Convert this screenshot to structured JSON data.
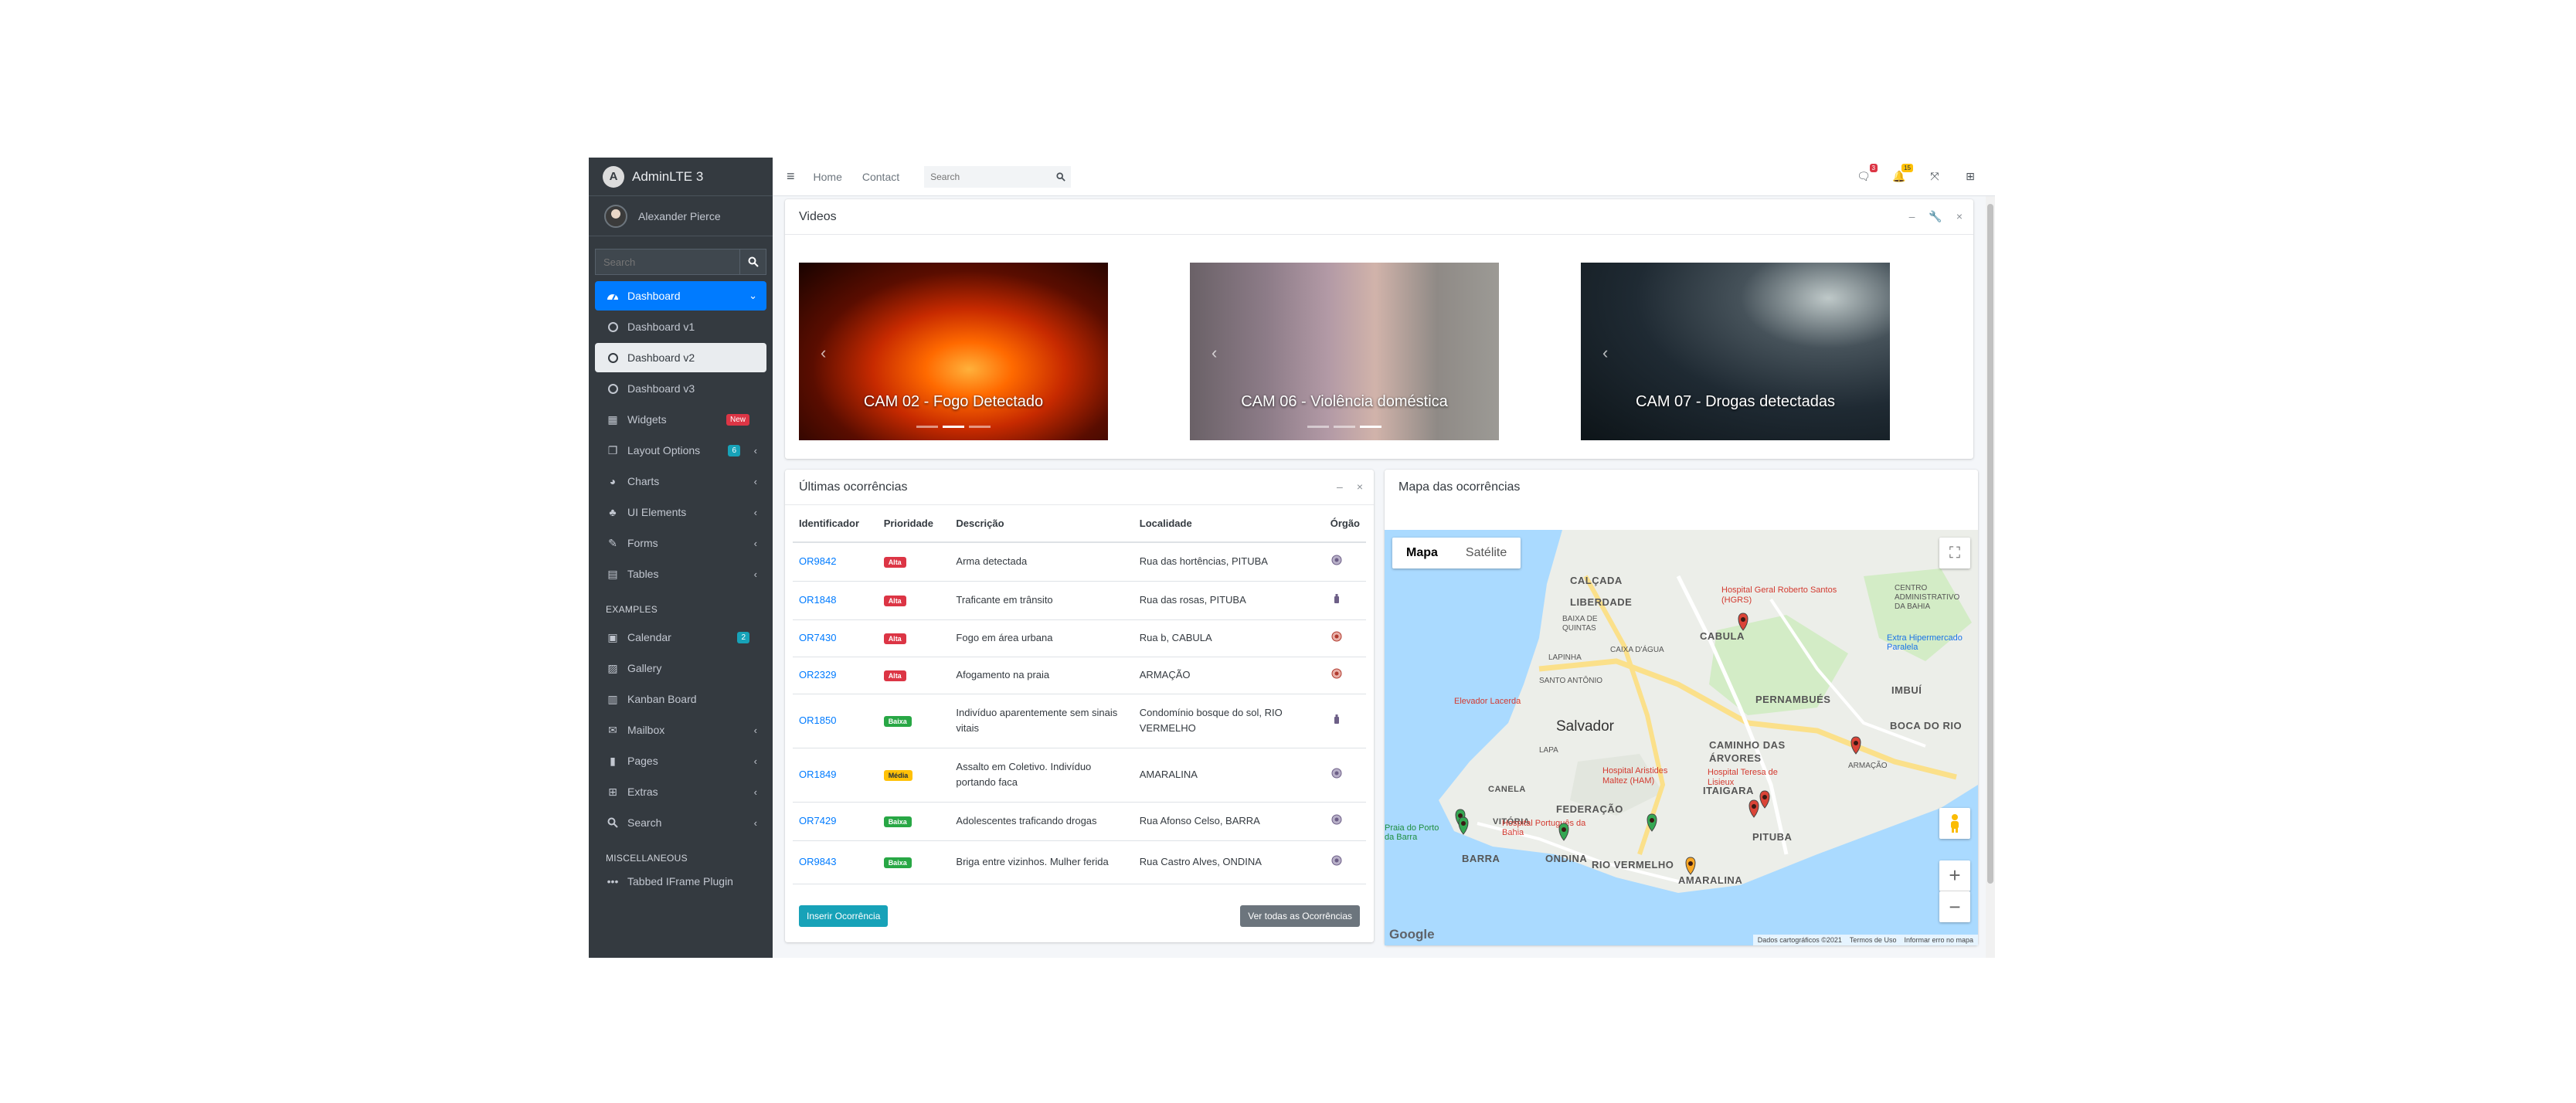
{
  "sidebar": {
    "brand": "AdminLTE 3",
    "user_name": "Alexander Pierce",
    "search_placeholder": "Search",
    "items": [
      {
        "label": "Dashboard"
      },
      {
        "label": "Dashboard v1"
      },
      {
        "label": "Dashboard v2"
      },
      {
        "label": "Dashboard v3"
      },
      {
        "label": "Widgets",
        "badge": "New"
      },
      {
        "label": "Layout Options",
        "badge": "6"
      },
      {
        "label": "Charts"
      },
      {
        "label": "UI Elements"
      },
      {
        "label": "Forms"
      },
      {
        "label": "Tables"
      }
    ],
    "header_examples": "EXAMPLES",
    "examples": [
      {
        "label": "Calendar",
        "badge": "2"
      },
      {
        "label": "Gallery"
      },
      {
        "label": "Kanban Board"
      },
      {
        "label": "Mailbox"
      },
      {
        "label": "Pages"
      },
      {
        "label": "Extras"
      },
      {
        "label": "Search"
      }
    ],
    "header_misc": "MISCELLANEOUS",
    "misc": [
      {
        "label": "Tabbed IFrame Plugin"
      }
    ]
  },
  "topbar": {
    "home": "Home",
    "contact": "Contact",
    "search_placeholder": "Search",
    "messages_count": "3",
    "notifications_count": "15"
  },
  "videos": {
    "title": "Videos",
    "items": [
      {
        "caption": "CAM 02 - Fogo Detectado"
      },
      {
        "caption": "CAM 06 - Violência doméstica"
      },
      {
        "caption": "CAM 07 - Drogas detectadas"
      }
    ]
  },
  "occurrences": {
    "title": "Últimas ocorrências",
    "columns": [
      "Identificador",
      "Prioridade",
      "Descrição",
      "Localidade",
      "Órgão"
    ],
    "rows": [
      {
        "id": "OR9842",
        "priority": "Alta",
        "description": "Arma detectada",
        "location": "Rua das hortências, PITUBA",
        "agency": "police-badge-icon"
      },
      {
        "id": "OR1848",
        "priority": "Alta",
        "description": "Traficante em trânsito",
        "location": "Rua das rosas, PITUBA",
        "agency": "fire-extinguisher-icon"
      },
      {
        "id": "OR7430",
        "priority": "Alta",
        "description": "Fogo em área urbana",
        "location": "Rua b, CABULA",
        "agency": "fire-department-icon"
      },
      {
        "id": "OR2329",
        "priority": "Alta",
        "description": "Afogamento na praia",
        "location": "ARMAÇÃO",
        "agency": "fire-department-icon"
      },
      {
        "id": "OR1850",
        "priority": "Baixa",
        "description": "Indivíduo aparentemente sem sinais vitais",
        "location": "Condomínio bosque do sol, RIO VERMELHO",
        "agency": "fire-extinguisher-icon"
      },
      {
        "id": "OR1849",
        "priority": "Média",
        "description": "Assalto em Coletivo. Indivíduo portando faca",
        "location": "AMARALINA",
        "agency": "police-badge-icon"
      },
      {
        "id": "OR7429",
        "priority": "Baixa",
        "description": "Adolescentes traficando drogas",
        "location": "Rua Afonso Celso, BARRA",
        "agency": "police-badge-icon"
      },
      {
        "id": "OR9843",
        "priority": "Baixa",
        "description": "Briga entre vizinhos. Mulher ferida",
        "location": "Rua Castro Alves, ONDINA",
        "agency": "police-badge-icon"
      }
    ],
    "insert_button": "Inserir Ocorrência",
    "view_all_button": "Ver todas as Ocorrências"
  },
  "map": {
    "title": "Mapa das ocorrências",
    "type_map": "Mapa",
    "type_satellite": "Satélite",
    "labels": [
      "CALÇADA",
      "LIBERDADE",
      "CABULA",
      "PERNAMBUÉS",
      "BOCA DO RIO",
      "IMBUÍ",
      "CAMINHO DAS ÁRVORES",
      "ITAIGARA",
      "PITUBA",
      "FEDERAÇÃO",
      "RIO VERMELHO",
      "ONDINA",
      "BARRA",
      "AMARALINA",
      "CANELA",
      "VITÓRIA",
      "Salvador"
    ],
    "pois": [
      "Hospital Geral Roberto Santos (HGRS)",
      "Hospital Aristides Maltez (HAM)",
      "Hospital Teresa de Lisieux",
      "Hospital Português da Bahia",
      "Elevador Lacerda",
      "CENTRO ADMINISTRATIVO DA BAHIA",
      "Extra Hipermercado Paralela",
      "ARMAÇÃO",
      "LAPA",
      "Praia do Porto da Barra",
      "BAIXA DE QUINTAS",
      "CAIXA D'ÁGUA",
      "LAPINHA",
      "SANTO ANTÔNIO"
    ],
    "google": "Google",
    "attribution": [
      "Dados cartográficos ©2021",
      "Termos de Uso",
      "Informar erro no mapa"
    ]
  }
}
